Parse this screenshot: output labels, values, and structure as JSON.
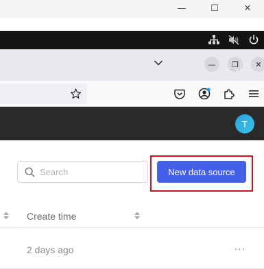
{
  "window": {
    "minimize_glyph": "—",
    "maximize_glyph": "☐",
    "close_glyph": "✕"
  },
  "system_tray": {
    "icons": [
      "network-icon",
      "volume-muted-icon",
      "power-icon"
    ]
  },
  "browser": {
    "tab_list_glyph": "⌄",
    "minimize_glyph": "—",
    "restore_glyph": "❐",
    "close_glyph": "✕",
    "toolbar_icons": [
      "bookmark-star-icon",
      "pocket-icon",
      "account-icon",
      "extensions-icon",
      "menu-icon"
    ]
  },
  "app": {
    "avatar_initial": "T",
    "search": {
      "placeholder": "Search",
      "value": ""
    },
    "new_data_source_label": "New data source",
    "table": {
      "columns": [
        "Create time"
      ],
      "rows": [
        {
          "create_time": "2 days ago",
          "actions": "···"
        }
      ]
    }
  },
  "colors": {
    "primary": "#4560e8",
    "header_bg": "#2a2a2a",
    "highlight": "#d0101a",
    "avatar": "#2aa3d8"
  }
}
